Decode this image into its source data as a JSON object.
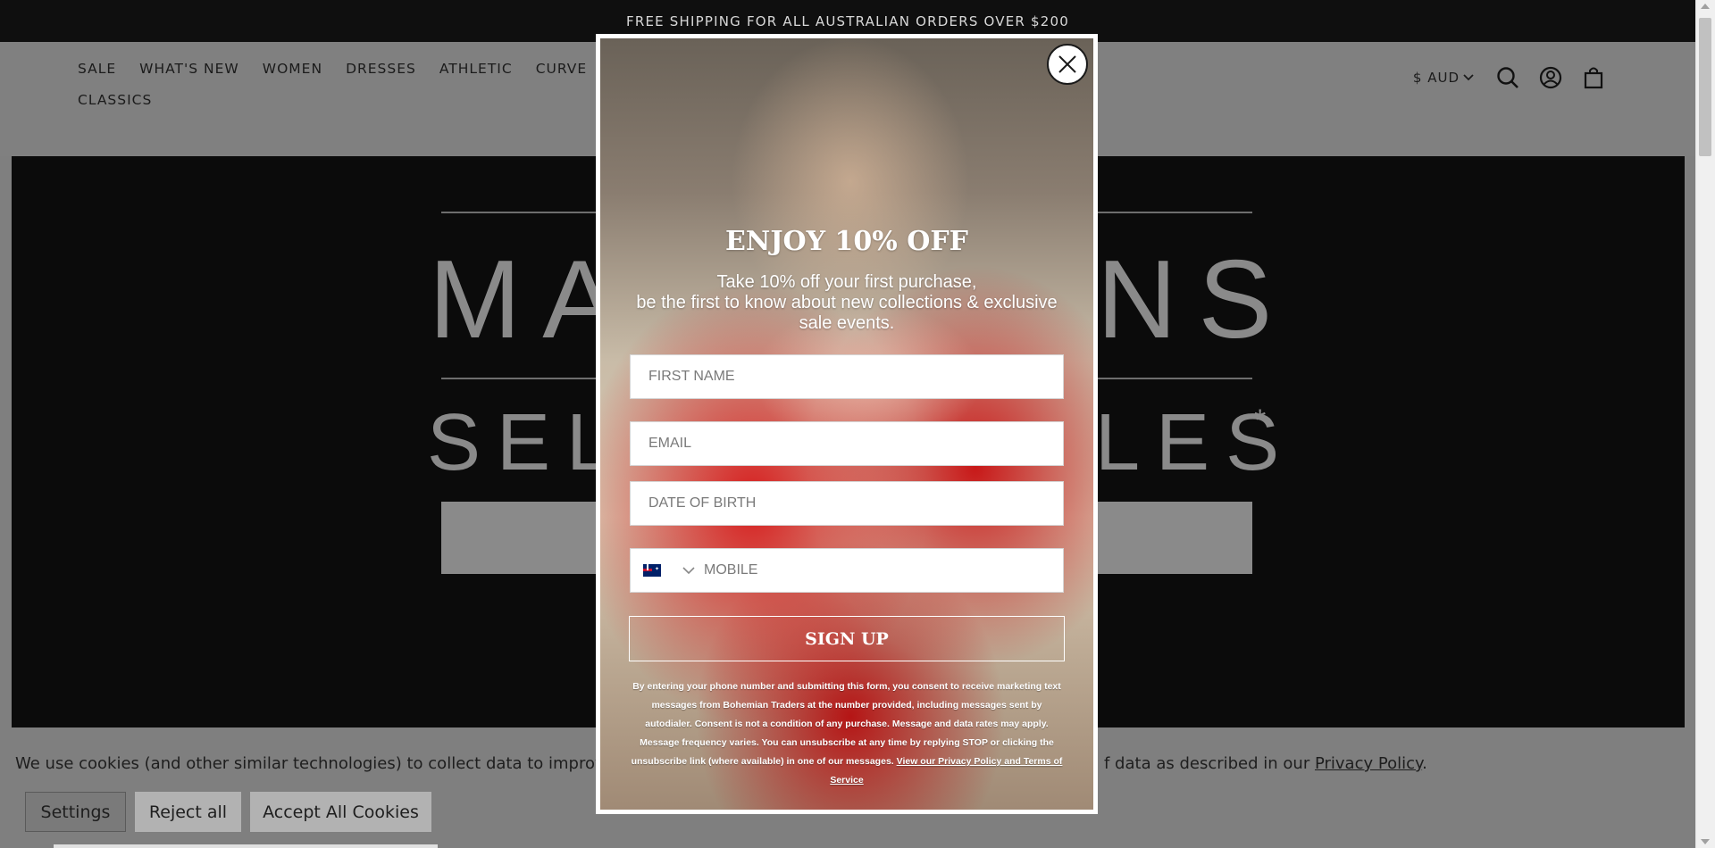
{
  "announcement": "FREE SHIPPING FOR ALL AUSTRALIAN ORDERS OVER $200",
  "nav": {
    "items": [
      "SALE",
      "WHAT'S NEW",
      "WOMEN",
      "DRESSES",
      "ATHLETIC",
      "CURVE",
      "CLASSICS"
    ]
  },
  "header": {
    "currency": "$ AUD",
    "icons": [
      "search-icon",
      "account-icon",
      "cart-icon"
    ]
  },
  "hero": {
    "line1_left": "MA",
    "line1_right": "NS",
    "line2_left": "SEL",
    "line2_right": "LES",
    "asterisk": "*"
  },
  "popup": {
    "title": "ENJOY 10% OFF",
    "subtitle_line1": "Take 10% off your first purchase,",
    "subtitle_line2": "be the first to know about new collections & exclusive sale events.",
    "fields": {
      "first_name_placeholder": "FIRST NAME",
      "email_placeholder": "EMAIL",
      "dob_placeholder": "DATE OF BIRTH",
      "mobile_placeholder": "MOBILE"
    },
    "signup_label": "SIGN UP",
    "legal_text": "By entering your phone number and submitting this form, you consent to receive marketing text messages from Bohemian Traders at the number provided, including messages sent by autodialer. Consent is not a condition of any purchase. Message and data rates may apply. Message frequency varies. You can unsubscribe at any time by replying STOP or clicking the unsubscribe link (where available) in one of our messages.",
    "legal_link": "View our Privacy Policy and Terms of Service"
  },
  "cookie": {
    "text_left": "We use cookies (and other similar technologies) to collect data to improve your shop",
    "text_right": "f data as described in our",
    "privacy_link": "Privacy Policy",
    "period": ".",
    "settings_label": "Settings",
    "reject_label": "Reject all",
    "accept_label": "Accept All Cookies"
  },
  "colors": {
    "announcement_bg": "#0f0f0f",
    "overlay": "#7f7f7f",
    "popup_red": "#d61d1d"
  }
}
